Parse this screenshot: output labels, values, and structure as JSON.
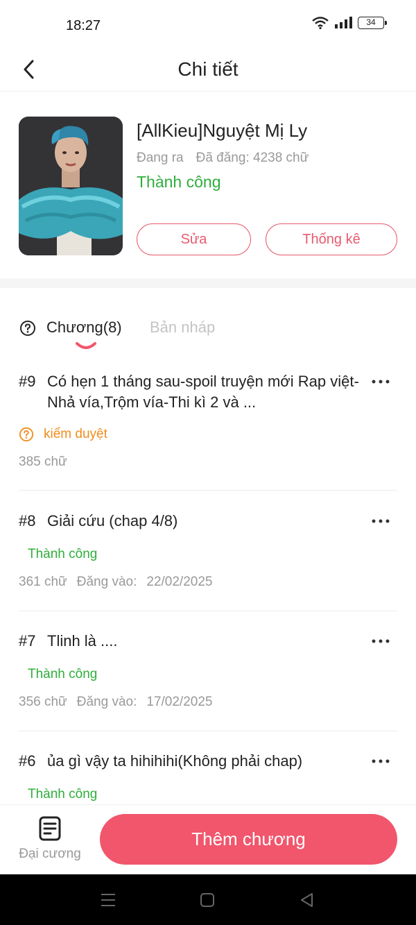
{
  "status_bar": {
    "time": "18:27",
    "battery": "34"
  },
  "header": {
    "title": "Chi tiết"
  },
  "book": {
    "title": "[AllKieu]Nguyệt Mị Ly",
    "progress_state": "Đang ra",
    "word_count": "Đã đăng: 4238 chữ",
    "status": "Thành công",
    "edit_label": "Sửa",
    "stats_label": "Thống kê"
  },
  "tabs": {
    "chapters": "Chương(8)",
    "drafts": "Bản nháp"
  },
  "chapters": [
    {
      "number": "#9",
      "title": "Có hẹn 1 tháng sau-spoil truyện mới Rap việt-Nhả vía,Trộm vía-Thi kì 2 và ...",
      "status": "kiểm duyệt",
      "words": "385 chữ",
      "posted_label": "",
      "posted_date": ""
    },
    {
      "number": "#8",
      "title": "Giải cứu (chap 4/8)",
      "status": "Thành công",
      "words": "361 chữ",
      "posted_label": "Đăng vào:",
      "posted_date": "22/02/2025"
    },
    {
      "number": "#7",
      "title": "Tlinh là ....",
      "status": "Thành công",
      "words": "356 chữ",
      "posted_label": "Đăng vào:",
      "posted_date": "17/02/2025"
    },
    {
      "number": "#6",
      "title": "ủa gì vậy ta hihihihi(Không phải chap)",
      "status": "Thành công",
      "words": "",
      "posted_label": "",
      "posted_date": ""
    }
  ],
  "bottom": {
    "outline_label": "Đại cương",
    "add_chapter_label": "Thêm chương"
  },
  "colors": {
    "accent": "#f1566c",
    "success": "#2eae3b",
    "pending": "#f08c1c",
    "muted": "#999999"
  },
  "icons": {
    "back": "chevron-left-icon",
    "more": "more-horizontal-icon",
    "help": "question-circle-icon",
    "outline": "document-icon"
  }
}
